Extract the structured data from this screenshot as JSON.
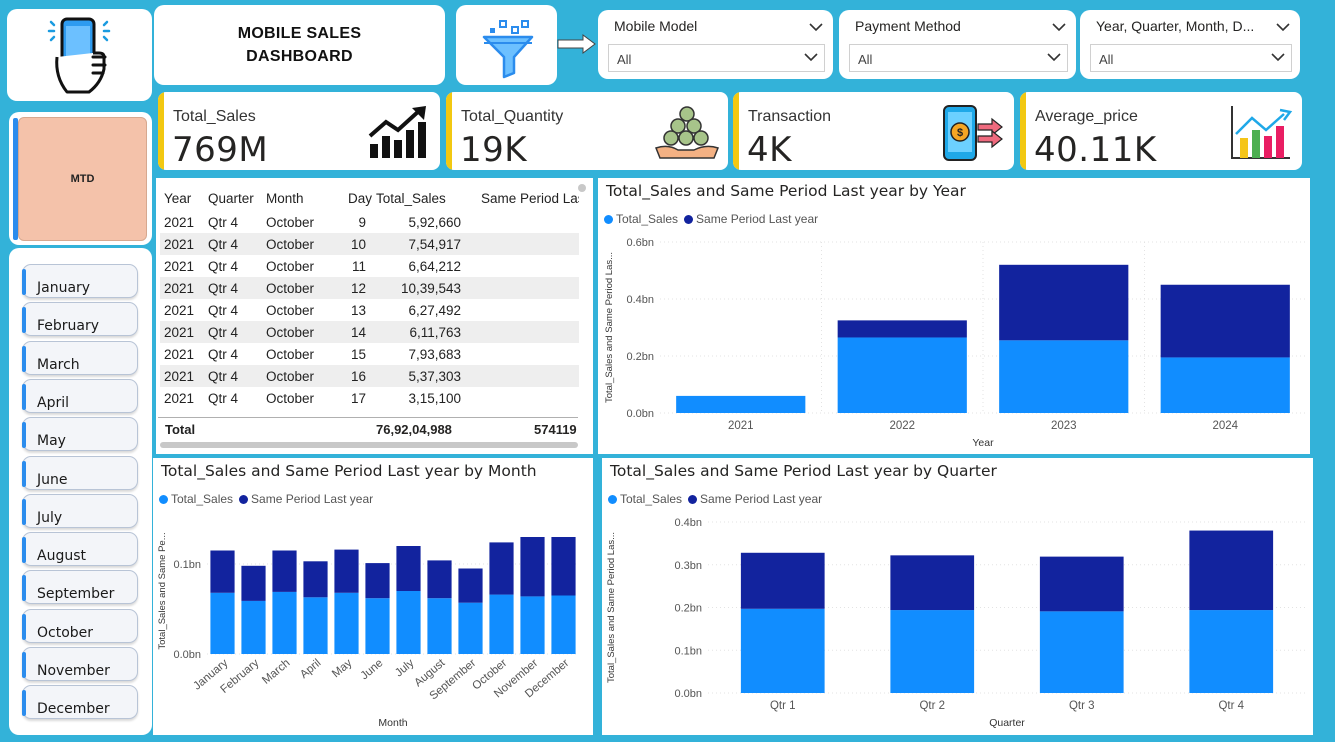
{
  "header": {
    "title_line1": "MOBILE SALES",
    "title_line2": "DASHBOARD",
    "logo_icon": "phone-hand-icon",
    "filter_icon": "funnel-filter-icon"
  },
  "slicers": [
    {
      "title": "Mobile Model",
      "value": "All"
    },
    {
      "title": "Payment Method",
      "value": "All"
    },
    {
      "title": "Year, Quarter, Month, D...",
      "value": "All"
    }
  ],
  "kpis": [
    {
      "label": "Total_Sales",
      "value": "769M",
      "icon": "trend-up-chart-icon"
    },
    {
      "label": "Total_Quantity",
      "value": "19K",
      "icon": "coins-hand-icon"
    },
    {
      "label": "Transaction",
      "value": "4K",
      "icon": "phone-payment-icon"
    },
    {
      "label": "Average_price",
      "value": "40.11K",
      "icon": "bar-chart-icon"
    }
  ],
  "mtd_label": "MTD",
  "months": [
    "January",
    "February",
    "March",
    "April",
    "May",
    "June",
    "July",
    "August",
    "September",
    "October",
    "November",
    "December"
  ],
  "table": {
    "headers": [
      "Year",
      "Quarter",
      "Month",
      "Day",
      "Total_Sales",
      "Same Period Last y"
    ],
    "rows": [
      [
        "2021",
        "Qtr 4",
        "October",
        "9",
        "5,92,660",
        ""
      ],
      [
        "2021",
        "Qtr 4",
        "October",
        "10",
        "7,54,917",
        ""
      ],
      [
        "2021",
        "Qtr 4",
        "October",
        "11",
        "6,64,212",
        ""
      ],
      [
        "2021",
        "Qtr 4",
        "October",
        "12",
        "10,39,543",
        ""
      ],
      [
        "2021",
        "Qtr 4",
        "October",
        "13",
        "6,27,492",
        ""
      ],
      [
        "2021",
        "Qtr 4",
        "October",
        "14",
        "6,11,763",
        ""
      ],
      [
        "2021",
        "Qtr 4",
        "October",
        "15",
        "7,93,683",
        ""
      ],
      [
        "2021",
        "Qtr 4",
        "October",
        "16",
        "5,37,303",
        ""
      ],
      [
        "2021",
        "Qtr 4",
        "October",
        "17",
        "3,15,100",
        ""
      ]
    ],
    "total_label": "Total",
    "total_sales": "76,92,04,988",
    "total_same_period": "574119"
  },
  "colors": {
    "total_sales": "#118dff",
    "same_period": "#12239e",
    "background": "#33b2d9",
    "accent_bar": "#f2c811"
  },
  "chart_data": [
    {
      "type": "bar",
      "stacked": true,
      "title": "Total_Sales and Same Period Last year by Year",
      "xlabel": "Year",
      "ylabel": "Total_Sales and Same Period Las...",
      "categories": [
        "2021",
        "2022",
        "2023",
        "2024"
      ],
      "series": [
        {
          "name": "Total_Sales",
          "values": [
            0.06,
            0.265,
            0.255,
            0.195
          ]
        },
        {
          "name": "Same Period Last year",
          "values": [
            0,
            0.06,
            0.265,
            0.255
          ]
        }
      ],
      "ylim": [
        0,
        0.6
      ],
      "yticks": [
        "0.0bn",
        "0.2bn",
        "0.4bn",
        "0.6bn"
      ],
      "grid": true,
      "legend": "top-left"
    },
    {
      "type": "bar",
      "stacked": true,
      "title": "Total_Sales and Same Period Last year by Month",
      "xlabel": "Month",
      "ylabel": "Total_Sales and Same Pe...",
      "categories": [
        "January",
        "February",
        "March",
        "April",
        "May",
        "June",
        "July",
        "August",
        "September",
        "October",
        "November",
        "December"
      ],
      "series": [
        {
          "name": "Total_Sales",
          "values": [
            0.068,
            0.059,
            0.069,
            0.063,
            0.068,
            0.062,
            0.07,
            0.062,
            0.057,
            0.066,
            0.064,
            0.065
          ]
        },
        {
          "name": "Same Period Last year",
          "values": [
            0.047,
            0.039,
            0.046,
            0.04,
            0.048,
            0.039,
            0.05,
            0.042,
            0.038,
            0.058,
            0.066,
            0.065
          ]
        }
      ],
      "ylim": [
        0,
        0.14
      ],
      "yticks": [
        "0.0bn",
        "0.1bn"
      ],
      "grid": true,
      "legend": "top-left"
    },
    {
      "type": "bar",
      "stacked": true,
      "title": "Total_Sales and Same Period Last year by Quarter",
      "xlabel": "Quarter",
      "ylabel": "Total_Sales and Same Period Las...",
      "categories": [
        "Qtr 1",
        "Qtr 2",
        "Qtr 3",
        "Qtr 4"
      ],
      "series": [
        {
          "name": "Total_Sales",
          "values": [
            0.197,
            0.194,
            0.191,
            0.194
          ]
        },
        {
          "name": "Same Period Last year",
          "values": [
            0.131,
            0.128,
            0.128,
            0.186
          ]
        }
      ],
      "ylim": [
        0,
        0.4
      ],
      "yticks": [
        "0.0bn",
        "0.1bn",
        "0.2bn",
        "0.3bn",
        "0.4bn"
      ],
      "grid": true,
      "legend": "top-left"
    }
  ]
}
